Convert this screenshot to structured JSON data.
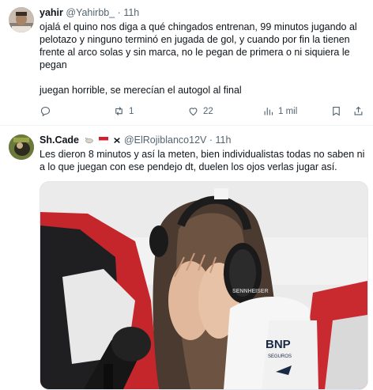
{
  "tweets": [
    {
      "name": "yahir",
      "handle": "@Yahirbb_",
      "separator": "·",
      "time": "11h",
      "paragraphs": [
        "ojalá el quino nos diga a qué chingados entrenan, 99 minutos jugando al pelotazo y ninguno terminó en jugada de gol, y cuando por fin la tienen frente al arco solas y sin marca, no le pegan de primera o ni siquiera le pegan",
        "juegan horrible, se merecían el autogol al final"
      ],
      "actions": {
        "reply_count": "",
        "retweet_count": "1",
        "like_count": "22",
        "views_count": "1 mil"
      }
    },
    {
      "name": "Sh.Cade",
      "handle": "@ElRojiblanco12V",
      "separator": "·",
      "time": "11h",
      "text": "Les dieron 8 minutos y así la meten, bien individualistas todas no saben ni a lo que juegan con ese pendejo dt, duelen los ojos verlas jugar así.",
      "media": {
        "headphone_brand": "SENNHEISER",
        "shirt_sponsor_main": "BNP",
        "shirt_sponsor_sub": "SEGUROS"
      }
    }
  ],
  "colors": {
    "text": "#0f1419",
    "muted": "#536471",
    "divider": "#eff3f4"
  }
}
